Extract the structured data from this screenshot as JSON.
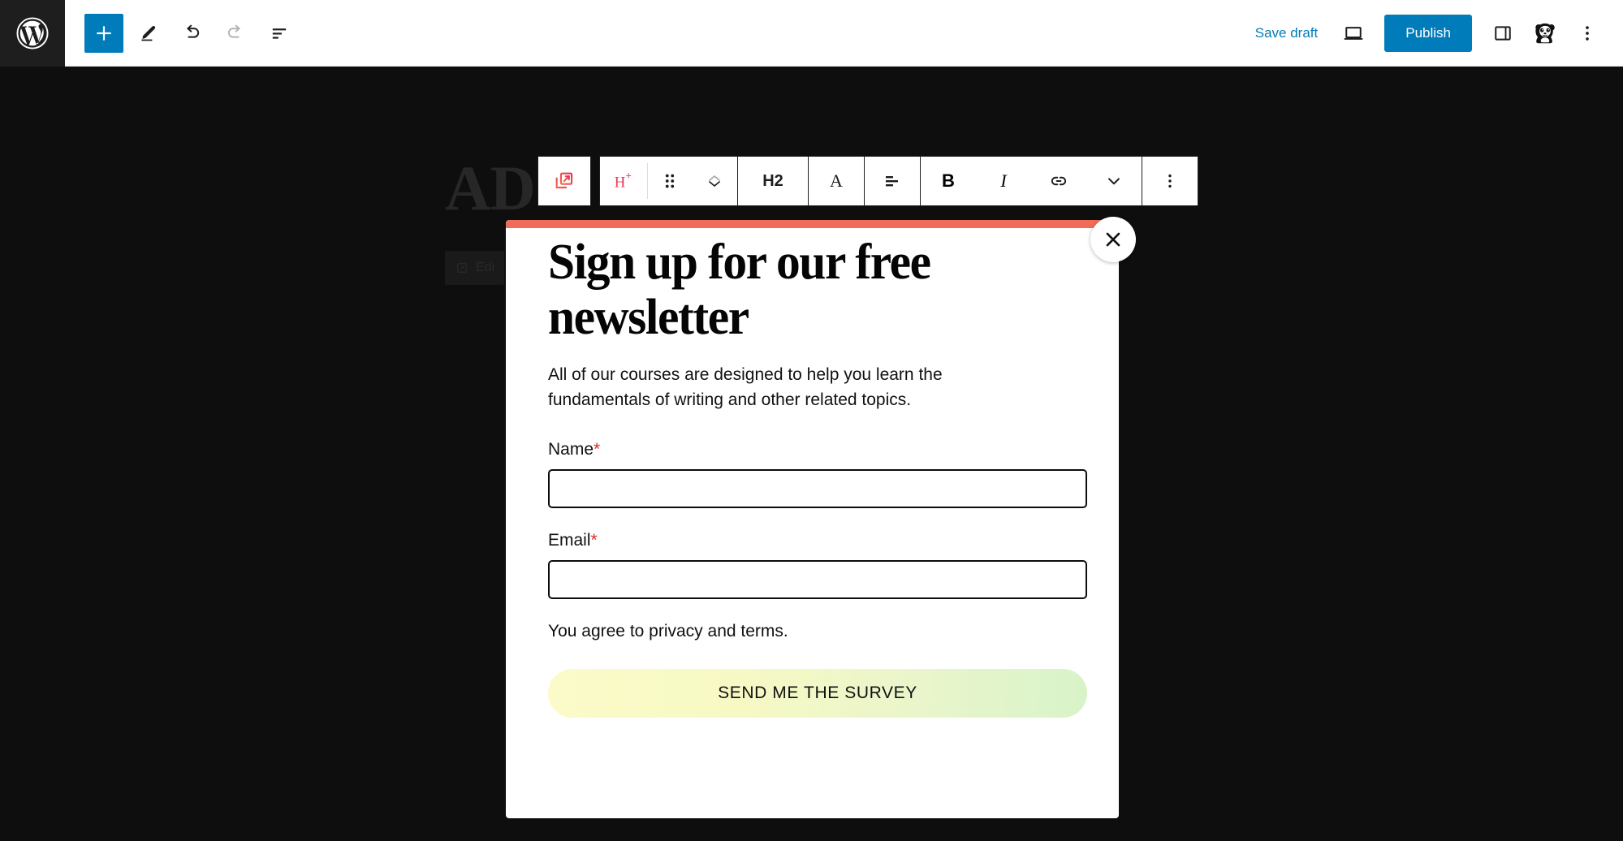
{
  "editor": {
    "logo_icon": "wordpress-logo-icon",
    "left_tools": [
      {
        "name": "add-block-button",
        "icon": "plus-icon",
        "label": "Add block"
      },
      {
        "name": "tools-button",
        "icon": "pencil-icon",
        "label": "Tools"
      },
      {
        "name": "undo-button",
        "icon": "undo-arrow-icon",
        "label": "Undo"
      },
      {
        "name": "redo-button",
        "icon": "redo-arrow-icon",
        "label": "Redo",
        "disabled": true
      },
      {
        "name": "list-view-button",
        "icon": "list-view-icon",
        "label": "Document overview"
      }
    ],
    "save_draft_label": "Save draft",
    "publish_label": "Publish",
    "preview_icon": "laptop-preview-icon",
    "settings_icon": "sidebar-panel-icon",
    "avatar_icon": "panda-avatar-icon",
    "options_icon": "three-dots-vertical-icon",
    "accent_color": "#007cba"
  },
  "block_toolbar": {
    "popup_button": {
      "name": "popup-maker-button",
      "icon": "external-link-popup-icon"
    },
    "items": [
      {
        "name": "change-heading-level-button",
        "icon": "heading-plus-icon",
        "label": ""
      },
      {
        "name": "drag-handle-button",
        "icon": "drag-dots-icon",
        "label": ""
      },
      {
        "name": "move-block-button",
        "icon": "move-up-down-chevrons-icon",
        "label": ""
      },
      {
        "name": "block-type-button",
        "icon": "h2-icon",
        "label": "H2"
      },
      {
        "name": "typography-button",
        "icon": "letter-a-icon",
        "label": "A"
      },
      {
        "name": "align-text-button",
        "icon": "align-text-icon",
        "label": ""
      },
      {
        "name": "bold-button",
        "icon": "bold-icon",
        "label": "B"
      },
      {
        "name": "italic-button",
        "icon": "italic-icon",
        "label": "I"
      },
      {
        "name": "link-button",
        "icon": "link-icon",
        "label": ""
      },
      {
        "name": "more-rich-text-button",
        "icon": "chevron-down-icon",
        "label": ""
      },
      {
        "name": "block-options-button",
        "icon": "three-dots-vertical-icon",
        "label": ""
      }
    ]
  },
  "canvas": {
    "background_heading": "AD",
    "background_badge_label": "Edi",
    "background_badge_icon": "popup-icon"
  },
  "modal": {
    "accent_color": "#ef6d58",
    "close_label": "Close",
    "close_icon": "close-x-icon",
    "title": "Sign up for our free newsletter",
    "description": "All of our courses are designed to help you learn the fundamentals of writing and other related topics.",
    "fields": [
      {
        "name": "name-field",
        "label": "Name",
        "required": true,
        "required_marker": "*",
        "value": "",
        "placeholder": ""
      },
      {
        "name": "email-field",
        "label": "Email",
        "required": true,
        "required_marker": "*",
        "value": "",
        "placeholder": ""
      }
    ],
    "terms_text": "You agree to privacy and terms.",
    "submit_label": "SEND ME THE SURVEY",
    "submit_gradient_from": "#fbfbc9",
    "submit_gradient_to": "#d8f3c9"
  }
}
